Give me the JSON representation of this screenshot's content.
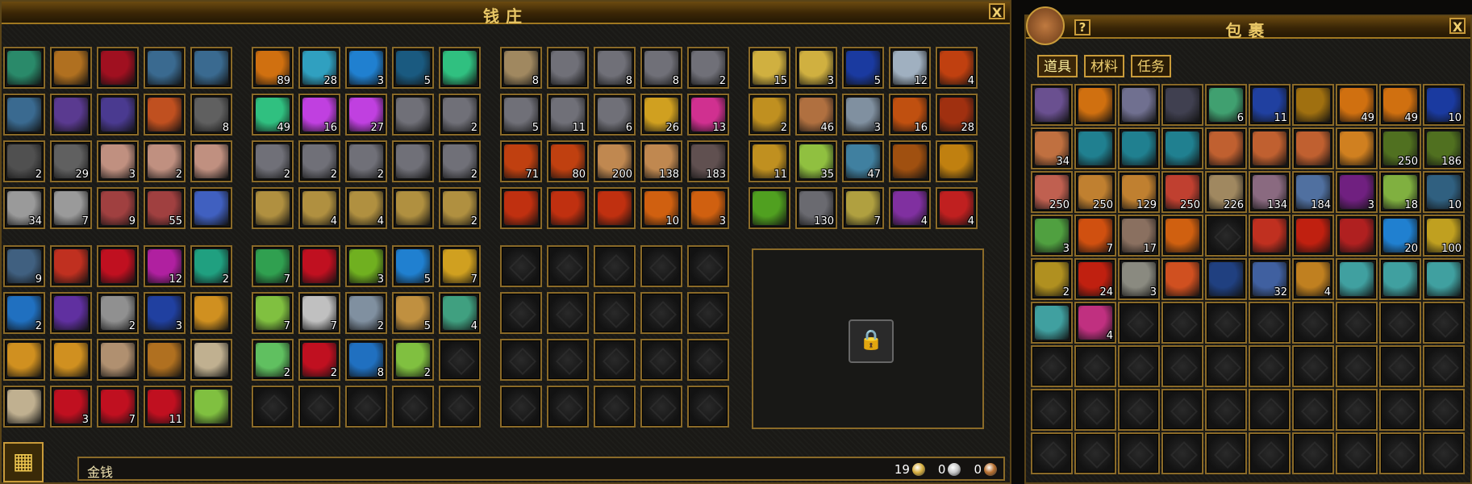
{
  "bank": {
    "title": "钱庄",
    "close_label": "X",
    "money_label": "金钱",
    "coins": [
      {
        "amount": "19",
        "color": "#d8b040"
      },
      {
        "amount": "0",
        "color": "#c8c8c8"
      },
      {
        "amount": "0",
        "color": "#b87030"
      }
    ],
    "lock_icon": "lock-icon",
    "corner_icon": "expand-icon",
    "groups": [
      {
        "slots": [
          {
            "c": "#2a8a6a",
            "q": ""
          },
          {
            "c": "#b07020",
            "q": ""
          },
          {
            "c": "#a01020",
            "q": ""
          },
          {
            "c": "#3a6a90",
            "q": ""
          },
          {
            "c": "#3a6a90",
            "q": ""
          },
          {
            "c": "#3a6a90",
            "q": ""
          },
          {
            "c": "#5a3a90",
            "q": ""
          },
          {
            "c": "#4a3a90",
            "q": ""
          },
          {
            "c": "#c05020",
            "q": ""
          },
          {
            "c": "#606060",
            "q": "8"
          },
          {
            "c": "#505050",
            "q": "2"
          },
          {
            "c": "#606060",
            "q": "29"
          },
          {
            "c": "#c09080",
            "q": "3"
          },
          {
            "c": "#c09080",
            "q": "2"
          },
          {
            "c": "#c09080",
            "q": ""
          },
          {
            "c": "#9a9a9a",
            "q": "34"
          },
          {
            "c": "#9a9a9a",
            "q": "7"
          },
          {
            "c": "#a04040",
            "q": "9"
          },
          {
            "c": "#a04040",
            "q": "55"
          },
          {
            "c": "#4060c0",
            "q": ""
          }
        ]
      },
      {
        "slots": [
          {
            "c": "#d07010",
            "q": "89"
          },
          {
            "c": "#30a0c0",
            "q": "28"
          },
          {
            "c": "#2080d0",
            "q": "3"
          },
          {
            "c": "#1a5a80",
            "q": "5"
          },
          {
            "c": "#30c080",
            "q": ""
          },
          {
            "c": "#30c080",
            "q": "49"
          },
          {
            "c": "#c040e0",
            "q": "16"
          },
          {
            "c": "#c040e0",
            "q": "27"
          },
          {
            "c": "#707078",
            "q": ""
          },
          {
            "c": "#707078",
            "q": "2"
          },
          {
            "c": "#707078",
            "q": "2"
          },
          {
            "c": "#707078",
            "q": "2"
          },
          {
            "c": "#707078",
            "q": "2"
          },
          {
            "c": "#707078",
            "q": ""
          },
          {
            "c": "#707078",
            "q": "2"
          },
          {
            "c": "#b09040",
            "q": ""
          },
          {
            "c": "#b09040",
            "q": "4"
          },
          {
            "c": "#b09040",
            "q": "4"
          },
          {
            "c": "#b09040",
            "q": ""
          },
          {
            "c": "#b09040",
            "q": "2"
          }
        ]
      },
      {
        "slots": [
          {
            "c": "#a08860",
            "q": "8"
          },
          {
            "c": "#707078",
            "q": ""
          },
          {
            "c": "#707078",
            "q": "8"
          },
          {
            "c": "#707078",
            "q": "8"
          },
          {
            "c": "#707078",
            "q": "2"
          },
          {
            "c": "#707078",
            "q": "5"
          },
          {
            "c": "#707078",
            "q": "11"
          },
          {
            "c": "#707078",
            "q": "6"
          },
          {
            "c": "#d0a020",
            "q": "26"
          },
          {
            "c": "#d03090",
            "q": "13"
          },
          {
            "c": "#c04010",
            "q": "71"
          },
          {
            "c": "#c04010",
            "q": "80"
          },
          {
            "c": "#c08850",
            "q": "200"
          },
          {
            "c": "#c08850",
            "q": "138"
          },
          {
            "c": "#605050",
            "q": "183"
          },
          {
            "c": "#c03010",
            "q": ""
          },
          {
            "c": "#c03010",
            "q": ""
          },
          {
            "c": "#c03010",
            "q": ""
          },
          {
            "c": "#d06010",
            "q": "10"
          },
          {
            "c": "#d06010",
            "q": "3"
          }
        ]
      },
      {
        "slots": [
          {
            "c": "#d0b040",
            "q": "15"
          },
          {
            "c": "#d0b040",
            "q": "3"
          },
          {
            "c": "#1a3aa0",
            "q": "5"
          },
          {
            "c": "#a0b0c0",
            "q": "12"
          },
          {
            "c": "#c04010",
            "q": "4"
          },
          {
            "c": "#c09020",
            "q": "2"
          },
          {
            "c": "#b07040",
            "q": "46"
          },
          {
            "c": "#8090a0",
            "q": "3"
          },
          {
            "c": "#c05010",
            "q": "16"
          },
          {
            "c": "#a03010",
            "q": "28"
          },
          {
            "c": "#c09020",
            "q": "11"
          },
          {
            "c": "#90c040",
            "q": "35"
          },
          {
            "c": "#4080a0",
            "q": "47"
          },
          {
            "c": "#a05010",
            "q": ""
          },
          {
            "c": "#c08010",
            "q": ""
          },
          {
            "c": "#50a020",
            "q": ""
          },
          {
            "c": "#6a6a70",
            "q": "130"
          },
          {
            "c": "#b0a040",
            "q": "7"
          },
          {
            "c": "#8030a0",
            "q": "4"
          },
          {
            "c": "#c02020",
            "q": "4"
          }
        ]
      },
      {
        "slots": [
          {
            "c": "#406080",
            "q": "9"
          },
          {
            "c": "#c03020",
            "q": ""
          },
          {
            "c": "#c01020",
            "q": ""
          },
          {
            "c": "#b020a0",
            "q": "12"
          },
          {
            "c": "#20a080",
            "q": "2"
          },
          {
            "c": "#2070c0",
            "q": "2"
          },
          {
            "c": "#6030a0",
            "q": ""
          },
          {
            "c": "#909090",
            "q": "2"
          },
          {
            "c": "#2040a0",
            "q": "3"
          },
          {
            "c": "#d09020",
            "q": ""
          },
          {
            "c": "#d09020",
            "q": ""
          },
          {
            "c": "#d09020",
            "q": ""
          },
          {
            "c": "#b09070",
            "q": ""
          },
          {
            "c": "#b07020",
            "q": ""
          },
          {
            "c": "#c0b090",
            "q": ""
          },
          {
            "c": "#c0b090",
            "q": ""
          },
          {
            "c": "#c01020",
            "q": "3"
          },
          {
            "c": "#c01020",
            "q": "7"
          },
          {
            "c": "#c01020",
            "q": "11"
          },
          {
            "c": "#80c040",
            "q": ""
          }
        ]
      },
      {
        "slots": [
          {
            "c": "#30a050",
            "q": "7"
          },
          {
            "c": "#c01020",
            "q": ""
          },
          {
            "c": "#70b020",
            "q": "3"
          },
          {
            "c": "#2080d0",
            "q": "5"
          },
          {
            "c": "#d0a020",
            "q": "7"
          },
          {
            "c": "#80c040",
            "q": "7"
          },
          {
            "c": "#c0c0c0",
            "q": "7"
          },
          {
            "c": "#8090a0",
            "q": "2"
          },
          {
            "c": "#c09040",
            "q": "5"
          },
          {
            "c": "#40a080",
            "q": "4"
          },
          {
            "c": "#60c060",
            "q": "2"
          },
          {
            "c": "#c01020",
            "q": "2"
          },
          {
            "c": "#2070c0",
            "q": "8"
          },
          {
            "c": "#80c040",
            "q": "2"
          },
          {
            "c": "",
            "q": ""
          },
          {
            "c": "",
            "q": ""
          },
          {
            "c": "",
            "q": ""
          },
          {
            "c": "",
            "q": ""
          },
          {
            "c": "",
            "q": ""
          },
          {
            "c": "",
            "q": ""
          }
        ]
      },
      {
        "slots": [
          {
            "c": "",
            "q": ""
          },
          {
            "c": "",
            "q": ""
          },
          {
            "c": "",
            "q": ""
          },
          {
            "c": "",
            "q": ""
          },
          {
            "c": "",
            "q": ""
          },
          {
            "c": "",
            "q": ""
          },
          {
            "c": "",
            "q": ""
          },
          {
            "c": "",
            "q": ""
          },
          {
            "c": "",
            "q": ""
          },
          {
            "c": "",
            "q": ""
          },
          {
            "c": "",
            "q": ""
          },
          {
            "c": "",
            "q": ""
          },
          {
            "c": "",
            "q": ""
          },
          {
            "c": "",
            "q": ""
          },
          {
            "c": "",
            "q": ""
          },
          {
            "c": "",
            "q": ""
          },
          {
            "c": "",
            "q": ""
          },
          {
            "c": "",
            "q": ""
          },
          {
            "c": "",
            "q": ""
          },
          {
            "c": "",
            "q": ""
          }
        ]
      }
    ]
  },
  "bag": {
    "title": "包裹",
    "close_label": "X",
    "help_label": "?",
    "tabs": [
      "道具",
      "材料",
      "任务"
    ],
    "slots": [
      {
        "c": "#6a5090",
        "q": ""
      },
      {
        "c": "#d07010",
        "q": ""
      },
      {
        "c": "#707090",
        "q": ""
      },
      {
        "c": "#404050",
        "q": ""
      },
      {
        "c": "#40a070",
        "q": "6"
      },
      {
        "c": "#2040a0",
        "q": "11"
      },
      {
        "c": "#a07010",
        "q": ""
      },
      {
        "c": "#d07010",
        "q": "49"
      },
      {
        "c": "#d07010",
        "q": "49"
      },
      {
        "c": "#1a3aa0",
        "q": "10"
      },
      {
        "c": "#c07040",
        "q": "34"
      },
      {
        "c": "#208090",
        "q": ""
      },
      {
        "c": "#208090",
        "q": ""
      },
      {
        "c": "#208090",
        "q": ""
      },
      {
        "c": "#c06030",
        "q": ""
      },
      {
        "c": "#c06030",
        "q": ""
      },
      {
        "c": "#c06030",
        "q": ""
      },
      {
        "c": "#d08020",
        "q": ""
      },
      {
        "c": "#507020",
        "q": "250"
      },
      {
        "c": "#507020",
        "q": "186"
      },
      {
        "c": "#c06050",
        "q": "250"
      },
      {
        "c": "#c08030",
        "q": "250"
      },
      {
        "c": "#c08030",
        "q": "129"
      },
      {
        "c": "#c04030",
        "q": "250"
      },
      {
        "c": "#a08860",
        "q": "226"
      },
      {
        "c": "#8a6a80",
        "q": "134"
      },
      {
        "c": "#5070a0",
        "q": "184"
      },
      {
        "c": "#702080",
        "q": "3"
      },
      {
        "c": "#80b040",
        "q": "18"
      },
      {
        "c": "#306080",
        "q": "10"
      },
      {
        "c": "#50a040",
        "q": "3"
      },
      {
        "c": "#d05010",
        "q": "7"
      },
      {
        "c": "#8a7060",
        "q": "17"
      },
      {
        "c": "#d06010",
        "q": ""
      },
      {
        "c": "",
        "q": ""
      },
      {
        "c": "#c03020",
        "q": ""
      },
      {
        "c": "#c02010",
        "q": ""
      },
      {
        "c": "#b02020",
        "q": ""
      },
      {
        "c": "#2080d0",
        "q": "20"
      },
      {
        "c": "#c0a020",
        "q": "100"
      },
      {
        "c": "#b09020",
        "q": "2"
      },
      {
        "c": "#c02010",
        "q": "24"
      },
      {
        "c": "#8a8a80",
        "q": "3"
      },
      {
        "c": "#d05020",
        "q": ""
      },
      {
        "c": "#204080",
        "q": ""
      },
      {
        "c": "#4060a0",
        "q": "32"
      },
      {
        "c": "#c08020",
        "q": "4"
      },
      {
        "c": "#40a0a0",
        "q": ""
      },
      {
        "c": "#40a0a0",
        "q": ""
      },
      {
        "c": "#40a0a0",
        "q": ""
      },
      {
        "c": "#40a0a0",
        "q": ""
      },
      {
        "c": "#c03080",
        "q": "4"
      },
      {
        "c": "",
        "q": ""
      },
      {
        "c": "",
        "q": ""
      },
      {
        "c": "",
        "q": ""
      },
      {
        "c": "",
        "q": ""
      },
      {
        "c": "",
        "q": ""
      },
      {
        "c": "",
        "q": ""
      },
      {
        "c": "",
        "q": ""
      },
      {
        "c": "",
        "q": ""
      },
      {
        "c": "",
        "q": ""
      },
      {
        "c": "",
        "q": ""
      },
      {
        "c": "",
        "q": ""
      },
      {
        "c": "",
        "q": ""
      },
      {
        "c": "",
        "q": ""
      },
      {
        "c": "",
        "q": ""
      },
      {
        "c": "",
        "q": ""
      },
      {
        "c": "",
        "q": ""
      },
      {
        "c": "",
        "q": ""
      },
      {
        "c": "",
        "q": ""
      },
      {
        "c": "",
        "q": ""
      },
      {
        "c": "",
        "q": ""
      },
      {
        "c": "",
        "q": ""
      },
      {
        "c": "",
        "q": ""
      },
      {
        "c": "",
        "q": ""
      },
      {
        "c": "",
        "q": ""
      },
      {
        "c": "",
        "q": ""
      },
      {
        "c": "",
        "q": ""
      },
      {
        "c": "",
        "q": ""
      },
      {
        "c": "",
        "q": ""
      },
      {
        "c": "",
        "q": ""
      },
      {
        "c": "",
        "q": ""
      },
      {
        "c": "",
        "q": ""
      },
      {
        "c": "",
        "q": ""
      },
      {
        "c": "",
        "q": ""
      },
      {
        "c": "",
        "q": ""
      },
      {
        "c": "",
        "q": ""
      },
      {
        "c": "",
        "q": ""
      },
      {
        "c": "",
        "q": ""
      },
      {
        "c": "",
        "q": ""
      }
    ]
  }
}
